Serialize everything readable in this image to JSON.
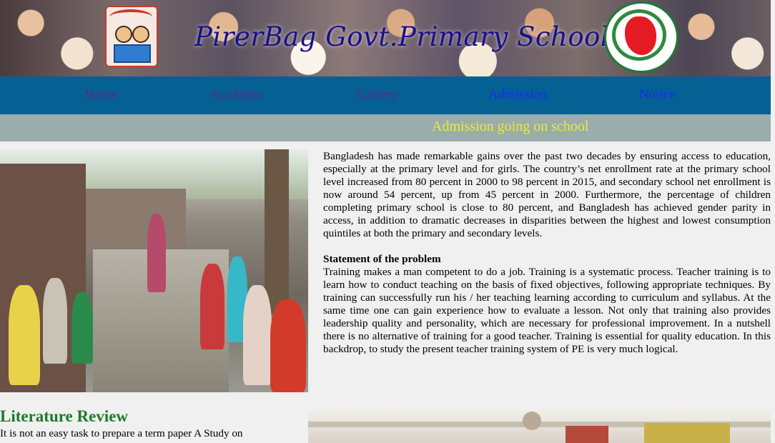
{
  "header": {
    "title": "PirerBag Govt.Primary School"
  },
  "nav": {
    "items": [
      {
        "label": "Home",
        "state": "visited"
      },
      {
        "label": "Academic",
        "state": "visited"
      },
      {
        "label": "Gallery",
        "state": "visited"
      },
      {
        "label": "Admission",
        "state": "unvisited"
      },
      {
        "label": "Notice",
        "state": "unvisited"
      }
    ]
  },
  "marquee": {
    "text": "Admission going on school"
  },
  "article": {
    "intro": "Bangladesh has made remarkable gains over the past two decades by ensuring access to education, especially at the primary level and for girls. The country’s net enrollment rate at the primary school level increased from 80 percent in 2000 to 98 percent in 2015, and secondary school net enrollment is now around 54 percent, up from 45 percent in 2000. Furthermore, the percentage of children completing primary school is close to 80 percent, and Bangladesh has achieved gender parity in access, in addition to dramatic decreases in disparities between the highest and lowest consumption quintiles at both the primary and secondary levels.",
    "problem_heading": "Statement of the problem",
    "problem_body": "Training makes a man competent to do a job. Training is a systematic process. Teacher training is to learn how to conduct teaching on the basis of fixed objectives, following appropriate techniques. By training can successfully run his / her teaching learning according to curriculum and syllabus. At the same time one can gain experience how to evaluate a lesson. Not only that training also provides leadership quality and personality, which are necessary for professional improvement. In a nutshell there is no alternative of training for a good teacher. Training is essential for quality education. In this backdrop, to study the present teacher training system of PE is very much logical."
  },
  "literature": {
    "title": "Literature Review",
    "body": "It is not an easy task to prepare a term paper A Study on"
  },
  "colors": {
    "nav_bg": "#056093",
    "marquee_bg": "#99adad",
    "marquee_text": "#eaea3c",
    "heading_green": "#1d7a2a",
    "title_blue": "#1a0f8c"
  }
}
